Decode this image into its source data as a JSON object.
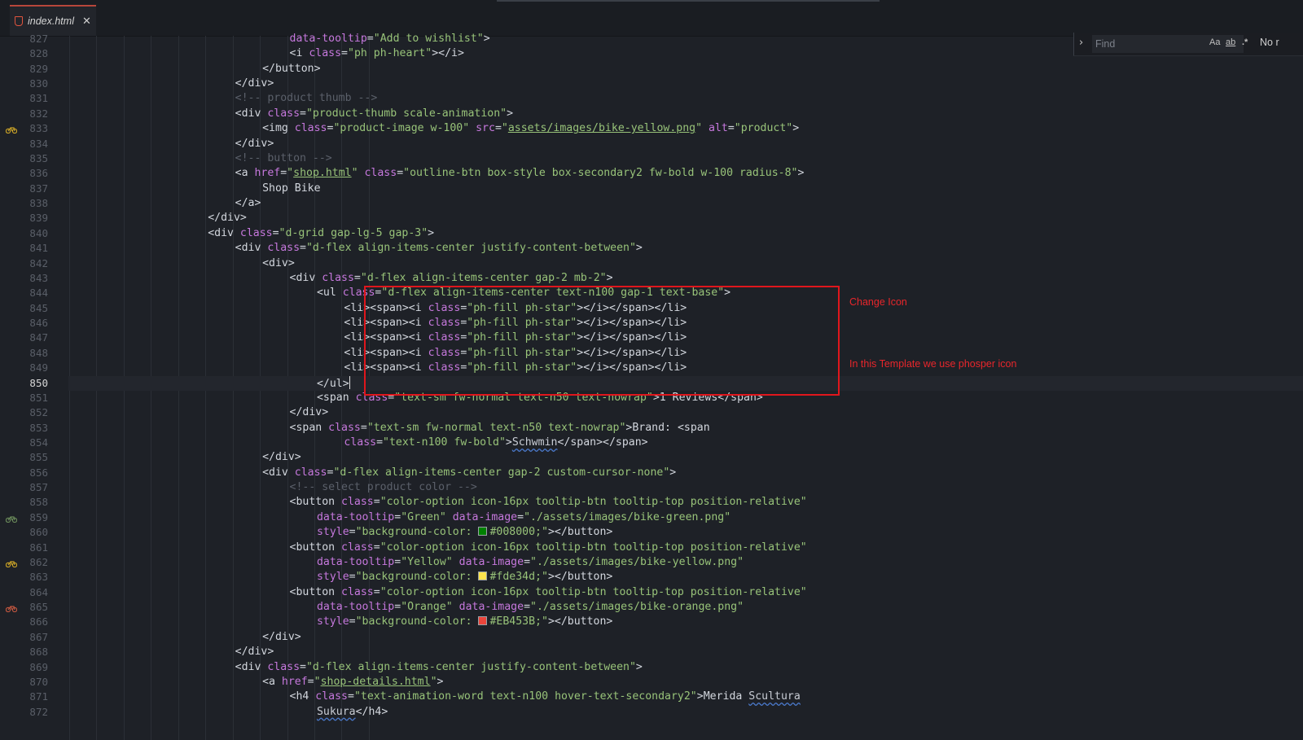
{
  "tab": {
    "filename": "index.html",
    "close": "✕"
  },
  "find": {
    "placeholder": "Find",
    "opt_case": "Aa",
    "opt_word": "ab",
    "opt_regex": ".*",
    "result": "No r"
  },
  "annotations": {
    "change_icon": "Change Icon",
    "template_note": "In this Template we use phosper icon"
  },
  "colors": {
    "green": "#008000",
    "yellow": "#fde34d",
    "orange": "#EB453B",
    "annotation_red": "#e0161c"
  },
  "editor": {
    "current_line": "850",
    "lines": [
      {
        "n": "827",
        "indent": 10,
        "tokens": [
          [
            "att",
            "data-tooltip"
          ],
          [
            "tag",
            "="
          ],
          [
            "str",
            "\"Add to wishlist\""
          ],
          [
            "tag",
            ">"
          ]
        ]
      },
      {
        "n": "828",
        "indent": 10,
        "tokens": [
          [
            "tag",
            "<i "
          ],
          [
            "att",
            "class"
          ],
          [
            "tag",
            "="
          ],
          [
            "str",
            "\"ph ph-heart\""
          ],
          [
            "tag",
            "></i>"
          ]
        ]
      },
      {
        "n": "829",
        "indent": 9,
        "tokens": [
          [
            "tag",
            "</button>"
          ]
        ]
      },
      {
        "n": "830",
        "indent": 8,
        "tokens": [
          [
            "tag",
            "</div>"
          ]
        ]
      },
      {
        "n": "831",
        "indent": 8,
        "tokens": [
          [
            "com",
            "<!-- product thumb -->"
          ]
        ]
      },
      {
        "n": "832",
        "indent": 8,
        "tokens": [
          [
            "tag",
            "<div "
          ],
          [
            "att",
            "class"
          ],
          [
            "tag",
            "="
          ],
          [
            "str",
            "\"product-thumb scale-animation\""
          ],
          [
            "tag",
            ">"
          ]
        ]
      },
      {
        "n": "833",
        "indent": 9,
        "icon": "bike-yellow",
        "tokens": [
          [
            "tag",
            "<img "
          ],
          [
            "att",
            "class"
          ],
          [
            "tag",
            "="
          ],
          [
            "str",
            "\"product-image w-100\" "
          ],
          [
            "att",
            "src"
          ],
          [
            "tag",
            "="
          ],
          [
            "str",
            "\""
          ],
          [
            "url",
            "assets/images/bike-yellow.png"
          ],
          [
            "str",
            "\" "
          ],
          [
            "att",
            "alt"
          ],
          [
            "tag",
            "="
          ],
          [
            "str",
            "\"product\""
          ],
          [
            "tag",
            ">"
          ]
        ]
      },
      {
        "n": "834",
        "indent": 8,
        "tokens": [
          [
            "tag",
            "</div>"
          ]
        ]
      },
      {
        "n": "835",
        "indent": 8,
        "tokens": [
          [
            "com",
            "<!-- button -->"
          ]
        ]
      },
      {
        "n": "836",
        "indent": 8,
        "tokens": [
          [
            "tag",
            "<a "
          ],
          [
            "att",
            "href"
          ],
          [
            "tag",
            "="
          ],
          [
            "str",
            "\""
          ],
          [
            "url",
            "shop.html"
          ],
          [
            "str",
            "\" "
          ],
          [
            "att",
            "class"
          ],
          [
            "tag",
            "="
          ],
          [
            "str",
            "\"outline-btn box-style box-secondary2 fw-bold w-100 radius-8\""
          ],
          [
            "tag",
            ">"
          ]
        ]
      },
      {
        "n": "837",
        "indent": 9,
        "tokens": [
          [
            "txt",
            "Shop Bike"
          ]
        ]
      },
      {
        "n": "838",
        "indent": 8,
        "tokens": [
          [
            "tag",
            "</a>"
          ]
        ]
      },
      {
        "n": "839",
        "indent": 7,
        "tokens": [
          [
            "tag",
            "</div>"
          ]
        ]
      },
      {
        "n": "840",
        "indent": 7,
        "tokens": [
          [
            "tag",
            "<div "
          ],
          [
            "att",
            "class"
          ],
          [
            "tag",
            "="
          ],
          [
            "str",
            "\"d-grid gap-lg-5 gap-3\""
          ],
          [
            "tag",
            ">"
          ]
        ]
      },
      {
        "n": "841",
        "indent": 8,
        "tokens": [
          [
            "tag",
            "<div "
          ],
          [
            "att",
            "class"
          ],
          [
            "tag",
            "="
          ],
          [
            "str",
            "\"d-flex align-items-center justify-content-between\""
          ],
          [
            "tag",
            ">"
          ]
        ]
      },
      {
        "n": "842",
        "indent": 9,
        "tokens": [
          [
            "tag",
            "<div>"
          ]
        ]
      },
      {
        "n": "843",
        "indent": 10,
        "tokens": [
          [
            "tag",
            "<div "
          ],
          [
            "att",
            "class"
          ],
          [
            "tag",
            "="
          ],
          [
            "str",
            "\"d-flex align-items-center gap-2 mb-2\""
          ],
          [
            "tag",
            ">"
          ]
        ]
      },
      {
        "n": "844",
        "indent": 11,
        "tokens": [
          [
            "tag",
            "<ul "
          ],
          [
            "att",
            "class"
          ],
          [
            "tag",
            "="
          ],
          [
            "str",
            "\"d-flex align-items-center text-n100 gap-1 text-base\""
          ],
          [
            "tag",
            ">"
          ]
        ]
      },
      {
        "n": "845",
        "indent": 12,
        "tokens": [
          [
            "tag",
            "<li><span><i "
          ],
          [
            "att",
            "class"
          ],
          [
            "tag",
            "="
          ],
          [
            "str",
            "\"ph-fill ph-star\""
          ],
          [
            "tag",
            "></i></span></li>"
          ]
        ]
      },
      {
        "n": "846",
        "indent": 12,
        "tokens": [
          [
            "tag",
            "<li><span><i "
          ],
          [
            "att",
            "class"
          ],
          [
            "tag",
            "="
          ],
          [
            "str",
            "\"ph-fill ph-star\""
          ],
          [
            "tag",
            "></i></span></li>"
          ]
        ]
      },
      {
        "n": "847",
        "indent": 12,
        "tokens": [
          [
            "tag",
            "<li><span><i "
          ],
          [
            "att",
            "class"
          ],
          [
            "tag",
            "="
          ],
          [
            "str",
            "\"ph-fill ph-star\""
          ],
          [
            "tag",
            "></i></span></li>"
          ]
        ]
      },
      {
        "n": "848",
        "indent": 12,
        "tokens": [
          [
            "tag",
            "<li><span><i "
          ],
          [
            "att",
            "class"
          ],
          [
            "tag",
            "="
          ],
          [
            "str",
            "\"ph-fill ph-star\""
          ],
          [
            "tag",
            "></i></span></li>"
          ]
        ]
      },
      {
        "n": "849",
        "indent": 12,
        "tokens": [
          [
            "tag",
            "<li><span><i "
          ],
          [
            "att",
            "class"
          ],
          [
            "tag",
            "="
          ],
          [
            "str",
            "\"ph-fill ph-star\""
          ],
          [
            "tag",
            "></i></span></li>"
          ]
        ]
      },
      {
        "n": "850",
        "indent": 11,
        "caret": true,
        "tokens": [
          [
            "tag",
            "</ul>"
          ]
        ]
      },
      {
        "n": "851",
        "indent": 11,
        "tokens": [
          [
            "tag",
            "<span "
          ],
          [
            "att",
            "class"
          ],
          [
            "tag",
            "="
          ],
          [
            "str",
            "\"text-sm fw-normal text-n50 text-nowrap\""
          ],
          [
            "tag",
            ">"
          ],
          [
            "txt",
            "1 Reviews"
          ],
          [
            "tag",
            "</span>"
          ]
        ]
      },
      {
        "n": "852",
        "indent": 10,
        "tokens": [
          [
            "tag",
            "</div>"
          ]
        ]
      },
      {
        "n": "853",
        "indent": 10,
        "tokens": [
          [
            "tag",
            "<span "
          ],
          [
            "att",
            "class"
          ],
          [
            "tag",
            "="
          ],
          [
            "str",
            "\"text-sm fw-normal text-n50 text-nowrap\""
          ],
          [
            "tag",
            ">"
          ],
          [
            "txt",
            "Brand: "
          ],
          [
            "tag",
            "<span"
          ]
        ]
      },
      {
        "n": "854",
        "indent": 12,
        "tokens": [
          [
            "att",
            "class"
          ],
          [
            "tag",
            "="
          ],
          [
            "str",
            "\"text-n100 fw-bold\""
          ],
          [
            "tag",
            ">"
          ],
          [
            "wav",
            "Schwmin"
          ],
          [
            "tag",
            "</span></span>"
          ]
        ]
      },
      {
        "n": "855",
        "indent": 9,
        "tokens": [
          [
            "tag",
            "</div>"
          ]
        ]
      },
      {
        "n": "856",
        "indent": 9,
        "tokens": [
          [
            "tag",
            "<div "
          ],
          [
            "att",
            "class"
          ],
          [
            "tag",
            "="
          ],
          [
            "str",
            "\"d-flex align-items-center gap-2 custom-cursor-none\""
          ],
          [
            "tag",
            ">"
          ]
        ]
      },
      {
        "n": "857",
        "indent": 10,
        "tokens": [
          [
            "com",
            "<!-- select product color -->"
          ]
        ]
      },
      {
        "n": "858",
        "indent": 10,
        "tokens": [
          [
            "tag",
            "<button "
          ],
          [
            "att",
            "class"
          ],
          [
            "tag",
            "="
          ],
          [
            "str",
            "\"color-option icon-16px tooltip-btn tooltip-top position-relative\""
          ]
        ]
      },
      {
        "n": "859",
        "indent": 11,
        "icon": "bike-green",
        "tokens": [
          [
            "att",
            "data-tooltip"
          ],
          [
            "tag",
            "="
          ],
          [
            "str",
            "\"Green\" "
          ],
          [
            "att",
            "data-image"
          ],
          [
            "tag",
            "="
          ],
          [
            "str",
            "\"./assets/images/bike-green.png\""
          ]
        ]
      },
      {
        "n": "860",
        "indent": 11,
        "tokens": [
          [
            "att",
            "style"
          ],
          [
            "tag",
            "="
          ],
          [
            "str",
            "\"background-color: "
          ],
          [
            "sw",
            "#008000"
          ],
          [
            "str",
            "#008000;\""
          ],
          [
            "tag",
            "></button>"
          ]
        ]
      },
      {
        "n": "861",
        "indent": 10,
        "tokens": [
          [
            "tag",
            "<button "
          ],
          [
            "att",
            "class"
          ],
          [
            "tag",
            "="
          ],
          [
            "str",
            "\"color-option icon-16px tooltip-btn tooltip-top position-relative\""
          ]
        ]
      },
      {
        "n": "862",
        "indent": 11,
        "icon": "bike-yellow",
        "tokens": [
          [
            "att",
            "data-tooltip"
          ],
          [
            "tag",
            "="
          ],
          [
            "str",
            "\"Yellow\" "
          ],
          [
            "att",
            "data-image"
          ],
          [
            "tag",
            "="
          ],
          [
            "str",
            "\"./assets/images/bike-yellow.png\""
          ]
        ]
      },
      {
        "n": "863",
        "indent": 11,
        "tokens": [
          [
            "att",
            "style"
          ],
          [
            "tag",
            "="
          ],
          [
            "str",
            "\"background-color: "
          ],
          [
            "sw",
            "#fde34d"
          ],
          [
            "str",
            "#fde34d;\""
          ],
          [
            "tag",
            "></button>"
          ]
        ]
      },
      {
        "n": "864",
        "indent": 10,
        "tokens": [
          [
            "tag",
            "<button "
          ],
          [
            "att",
            "class"
          ],
          [
            "tag",
            "="
          ],
          [
            "str",
            "\"color-option icon-16px tooltip-btn tooltip-top position-relative\""
          ]
        ]
      },
      {
        "n": "865",
        "indent": 11,
        "icon": "bike-orange",
        "tokens": [
          [
            "att",
            "data-tooltip"
          ],
          [
            "tag",
            "="
          ],
          [
            "str",
            "\"Orange\" "
          ],
          [
            "att",
            "data-image"
          ],
          [
            "tag",
            "="
          ],
          [
            "str",
            "\"./assets/images/bike-orange.png\""
          ]
        ]
      },
      {
        "n": "866",
        "indent": 11,
        "tokens": [
          [
            "att",
            "style"
          ],
          [
            "tag",
            "="
          ],
          [
            "str",
            "\"background-color: "
          ],
          [
            "sw",
            "#EB453B"
          ],
          [
            "str",
            "#EB453B;\""
          ],
          [
            "tag",
            "></button>"
          ]
        ]
      },
      {
        "n": "867",
        "indent": 9,
        "tokens": [
          [
            "tag",
            "</div>"
          ]
        ]
      },
      {
        "n": "868",
        "indent": 8,
        "tokens": [
          [
            "tag",
            "</div>"
          ]
        ]
      },
      {
        "n": "869",
        "indent": 8,
        "tokens": [
          [
            "tag",
            "<div "
          ],
          [
            "att",
            "class"
          ],
          [
            "tag",
            "="
          ],
          [
            "str",
            "\"d-flex align-items-center justify-content-between\""
          ],
          [
            "tag",
            ">"
          ]
        ]
      },
      {
        "n": "870",
        "indent": 9,
        "tokens": [
          [
            "tag",
            "<a "
          ],
          [
            "att",
            "href"
          ],
          [
            "tag",
            "="
          ],
          [
            "str",
            "\""
          ],
          [
            "url",
            "shop-details.html"
          ],
          [
            "str",
            "\""
          ],
          [
            "tag",
            ">"
          ]
        ]
      },
      {
        "n": "871",
        "indent": 10,
        "tokens": [
          [
            "tag",
            "<h4 "
          ],
          [
            "att",
            "class"
          ],
          [
            "tag",
            "="
          ],
          [
            "str",
            "\"text-animation-word text-n100 hover-text-secondary2\""
          ],
          [
            "tag",
            ">"
          ],
          [
            "txt",
            "Merida "
          ],
          [
            "wav",
            "Scultura"
          ]
        ]
      },
      {
        "n": "872",
        "indent": 11,
        "tokens": [
          [
            "wav",
            "Sukura"
          ],
          [
            "tag",
            "</h4>"
          ]
        ]
      }
    ]
  }
}
